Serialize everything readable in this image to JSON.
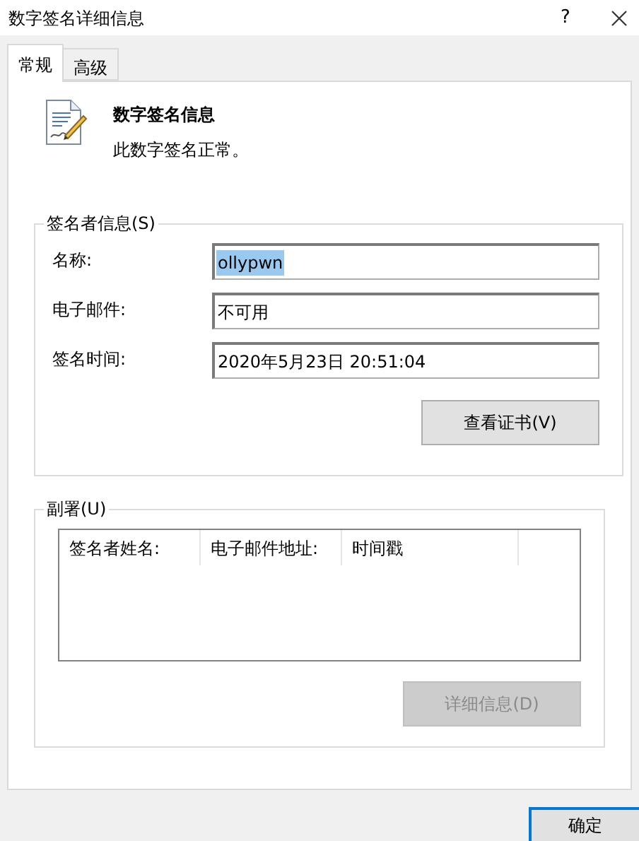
{
  "window": {
    "title": "数字签名详细信息",
    "help": "?"
  },
  "tabs": [
    {
      "label": "常规",
      "selected": true
    },
    {
      "label": "高级",
      "selected": false
    }
  ],
  "header": {
    "title": "数字签名信息",
    "status": "此数字签名正常。"
  },
  "signer_group": {
    "legend": "签名者信息(S)",
    "fields": [
      {
        "label": "名称:",
        "value": "ollypwn",
        "text_selected": true
      },
      {
        "label": "电子邮件:",
        "value": "不可用",
        "text_selected": false
      },
      {
        "label": "签名时间:",
        "value": "2020年5月23日 20:51:04",
        "text_selected": false
      }
    ],
    "button": {
      "label": "查看证书(V)",
      "disabled": false
    }
  },
  "countersig_group": {
    "legend": "副署(U)",
    "columns": [
      "签名者姓名:",
      "电子邮件地址:",
      "时间戳"
    ],
    "button": {
      "label": "详细信息(D)",
      "disabled": true
    }
  },
  "footer": {
    "button": {
      "label": "确定",
      "default": true
    }
  }
}
